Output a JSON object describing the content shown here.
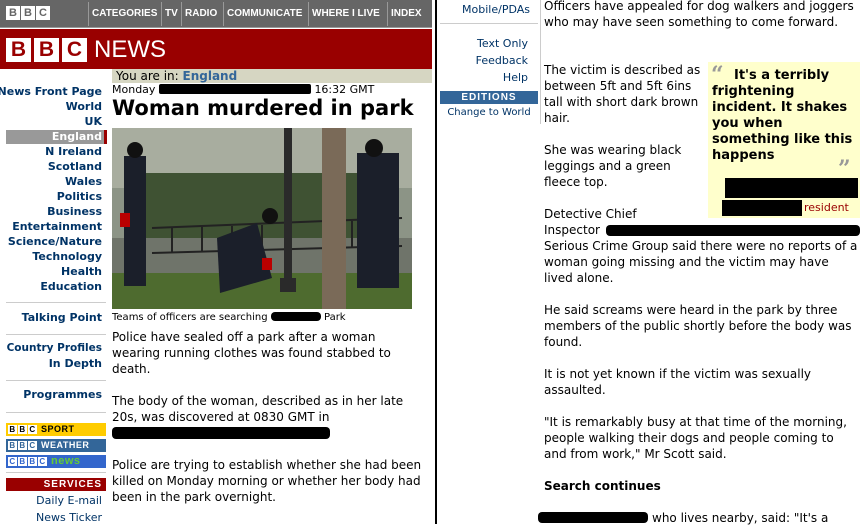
{
  "top_nav": {
    "logo": [
      "B",
      "B",
      "C"
    ],
    "items": [
      "CATEGORIES",
      "TV",
      "RADIO",
      "COMMUNICATE",
      "WHERE I LIVE",
      "INDEX"
    ]
  },
  "banner": {
    "logo": [
      "B",
      "B",
      "C"
    ],
    "title": "NEWS"
  },
  "breadcrumb": {
    "prefix": "You are in: ",
    "link": "England"
  },
  "dateline": {
    "day": "Monday",
    "time": "16:32 GMT"
  },
  "headline": "Woman murdered in park",
  "nav": {
    "items": [
      "News Front Page",
      "World",
      "UK",
      "England",
      "N Ireland",
      "Scotland",
      "Wales",
      "Politics",
      "Business",
      "Entertainment",
      "Science/Nature",
      "Technology",
      "Health",
      "Education"
    ],
    "talking_point": "Talking Point",
    "country_profiles": "Country Profiles",
    "in_depth": "In Depth",
    "programmes": "Programmes",
    "sport": "SPORT",
    "weather": "WEATHER",
    "cbbc": "news",
    "services": "SERVICES",
    "daily_email": "Daily E-mail",
    "news_ticker": "News Ticker"
  },
  "photo": {
    "caption_a": "Teams of officers are searching",
    "caption_b": "Park"
  },
  "article_left": {
    "p1": "Police have sealed off a park after a woman wearing running clothes was found stabbed to death.",
    "p2": "The body of the woman, described as in her late 20s, was discovered at 0830 GMT in",
    "p3": "Police are trying to establish whether she had been killed on Monday morning or whether her body had been in the park overnight."
  },
  "utility": {
    "mobile": "Mobile/PDAs",
    "text_only": "Text Only",
    "feedback": "Feedback",
    "help": "Help",
    "editions": "EDITIONS",
    "change": "Change to World"
  },
  "article_right": {
    "p0": "Officers have appealed for dog walkers and joggers who may have seen something to come forward.",
    "p1": "The victim is described as between 5ft and 5ft 6ins tall with short dark brown hair.",
    "p2": "She was wearing black leggings and a green fleece top.",
    "p3a": "Detective Chief",
    "p3b": "Inspector",
    "p3c": "Serious Crime Group said there were no reports of a woman going missing and the victim may have lived alone.",
    "p4": "He said screams were heard in the park by three members of the public shortly before the body was found.",
    "p5": "It is not yet known if the victim was sexually assaulted.",
    "p6": "\"It is remarkably busy at that time of the morning, people walking their dogs and people coming to and from work,\" Mr Scott said.",
    "subhead": "Search continues",
    "p7": "who lives nearby, said: \"It's a"
  },
  "quote": {
    "text": "It's a terribly frightening incident. It shakes you when something like this happens",
    "attribution": "resident"
  }
}
